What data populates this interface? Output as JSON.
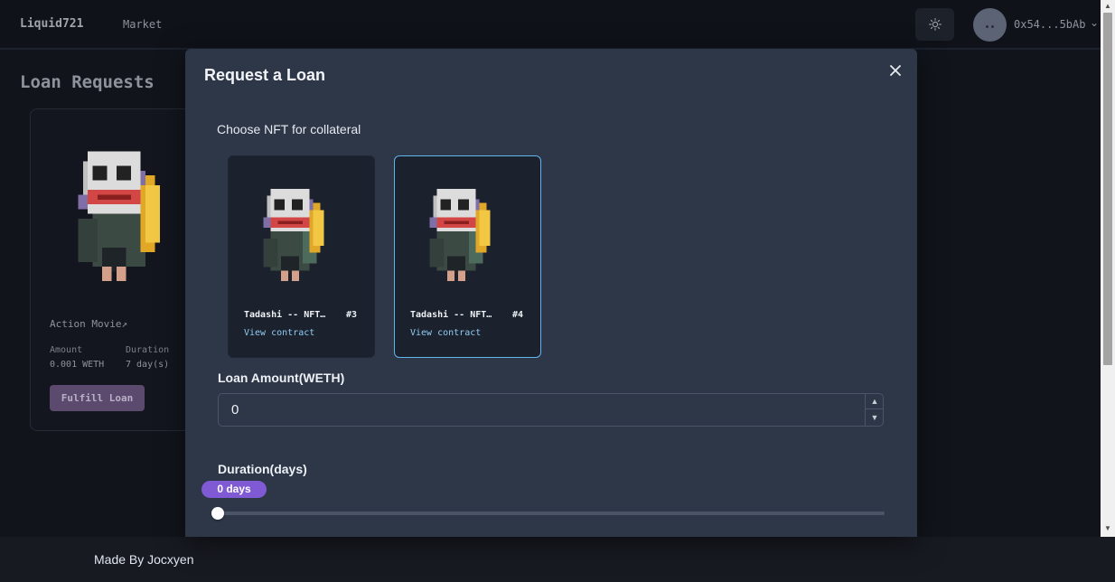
{
  "navbar": {
    "brand": "Liquid721",
    "market_link": "Market",
    "wallet_address": "0x54...5bAb"
  },
  "page": {
    "title": "Loan Requests",
    "card": {
      "name": "Action Movie",
      "amount_label": "Amount",
      "amount_value": "0.001 WETH",
      "duration_label": "Duration",
      "duration_value": "7 day(s)",
      "fulfill_label": "Fulfill Loan"
    }
  },
  "modal": {
    "title": "Request a Loan",
    "choose_label": "Choose NFT for collateral",
    "nfts": [
      {
        "name": "Tadashi -- NFT…",
        "id": "#3",
        "link": "View contract",
        "selected": false
      },
      {
        "name": "Tadashi -- NFT…",
        "id": "#4",
        "link": "View contract",
        "selected": true
      }
    ],
    "loan_amount_label": "Loan Amount(WETH)",
    "loan_amount_value": "0",
    "duration_label": "Duration(days)",
    "duration_badge": "0 days",
    "duration_value": 0
  },
  "footer": {
    "text": "Made By Jocxyen"
  },
  "colors": {
    "accent_purple": "#805ad5",
    "selected_border": "#63b3ed",
    "link_blue": "#90cdf4",
    "modal_bg": "#2d3748"
  }
}
